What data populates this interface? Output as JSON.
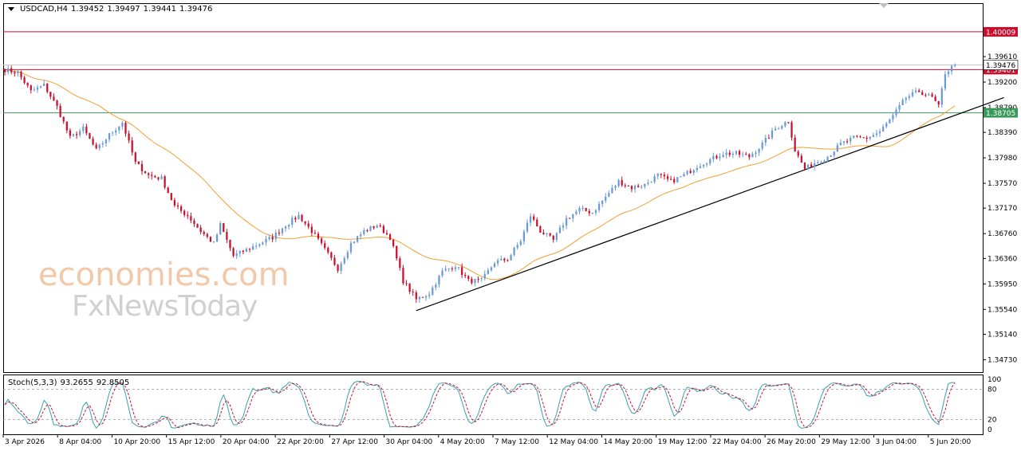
{
  "header": {
    "symbol": "USDCAD,H4",
    "open": "1.39452",
    "high": "1.39497",
    "low": "1.39441",
    "close": "1.39476"
  },
  "watermark": {
    "line1": "economies.com",
    "line2": "FxNewsToday"
  },
  "chart_data": [
    {
      "type": "candlestick",
      "title": "USDCAD,H4",
      "ylim": [
        1.3453,
        1.4047
      ],
      "y_ticks": [
        "1.34730",
        "1.35140",
        "1.35540",
        "1.35950",
        "1.36360",
        "1.36760",
        "1.37170",
        "1.37570",
        "1.37980",
        "1.38390",
        "1.38790",
        "1.39200",
        "1.39610"
      ],
      "x_ticks": [
        "3 Apr 2026",
        "8 Apr 04:00",
        "10 Apr 20:00",
        "15 Apr 12:00",
        "20 Apr 04:00",
        "22 Apr 20:00",
        "27 Apr 12:00",
        "30 Apr 04:00",
        "4 May 20:00",
        "7 May 12:00",
        "12 May 04:00",
        "14 May 20:00",
        "19 May 12:00",
        "22 May 04:00",
        "26 May 20:00",
        "29 May 12:00",
        "3 Jun 04:00",
        "5 Jun 20:00"
      ],
      "levels": [
        {
          "label": "1.40009",
          "value": 1.40009,
          "color": "#c8102e"
        },
        {
          "label": "1.39401",
          "value": 1.39401,
          "color": "#c8102e"
        },
        {
          "label": "1.38705",
          "value": 1.38705,
          "color": "#3a9a5c"
        },
        {
          "label": "1.39476",
          "value": 1.39476,
          "color": "#000000"
        }
      ],
      "trendline": {
        "start_value": 1.3552,
        "end_value": 1.3895,
        "color": "#000000"
      },
      "moving_average_color": "#f0a030",
      "bull_color": "#6a9ad8",
      "bear_color": "#c8102e",
      "anchors": [
        [
          0,
          1.394
        ],
        [
          4,
          1.3935
        ],
        [
          8,
          1.3905
        ],
        [
          12,
          1.3915
        ],
        [
          16,
          1.388
        ],
        [
          20,
          1.383
        ],
        [
          24,
          1.3845
        ],
        [
          28,
          1.381
        ],
        [
          32,
          1.3835
        ],
        [
          36,
          1.3855
        ],
        [
          40,
          1.379
        ],
        [
          44,
          1.377
        ],
        [
          48,
          1.3765
        ],
        [
          52,
          1.372
        ],
        [
          56,
          1.3705
        ],
        [
          60,
          1.368
        ],
        [
          64,
          1.366
        ],
        [
          66,
          1.369
        ],
        [
          70,
          1.364
        ],
        [
          74,
          1.365
        ],
        [
          78,
          1.366
        ],
        [
          82,
          1.367
        ],
        [
          86,
          1.369
        ],
        [
          90,
          1.3705
        ],
        [
          94,
          1.368
        ],
        [
          98,
          1.365
        ],
        [
          102,
          1.362
        ],
        [
          106,
          1.366
        ],
        [
          110,
          1.368
        ],
        [
          114,
          1.369
        ],
        [
          118,
          1.367
        ],
        [
          122,
          1.36
        ],
        [
          126,
          1.357
        ],
        [
          130,
          1.358
        ],
        [
          134,
          1.3615
        ],
        [
          138,
          1.3625
        ],
        [
          142,
          1.36
        ],
        [
          146,
          1.36
        ],
        [
          150,
          1.363
        ],
        [
          154,
          1.3635
        ],
        [
          158,
          1.3665
        ],
        [
          161,
          1.3705
        ],
        [
          164,
          1.368
        ],
        [
          168,
          1.3665
        ],
        [
          172,
          1.37
        ],
        [
          176,
          1.3715
        ],
        [
          180,
          1.371
        ],
        [
          184,
          1.3735
        ],
        [
          188,
          1.376
        ],
        [
          192,
          1.375
        ],
        [
          196,
          1.3755
        ],
        [
          200,
          1.377
        ],
        [
          204,
          1.376
        ],
        [
          208,
          1.377
        ],
        [
          212,
          1.3785
        ],
        [
          216,
          1.3795
        ],
        [
          220,
          1.3805
        ],
        [
          224,
          1.3805
        ],
        [
          228,
          1.38
        ],
        [
          232,
          1.382
        ],
        [
          236,
          1.3845
        ],
        [
          240,
          1.3858
        ],
        [
          242,
          1.381
        ],
        [
          245,
          1.378
        ],
        [
          248,
          1.379
        ],
        [
          252,
          1.38
        ],
        [
          256,
          1.382
        ],
        [
          260,
          1.383
        ],
        [
          264,
          1.383
        ],
        [
          268,
          1.384
        ],
        [
          272,
          1.3865
        ],
        [
          276,
          1.3895
        ],
        [
          280,
          1.3905
        ],
        [
          284,
          1.3895
        ],
        [
          286,
          1.388
        ],
        [
          288,
          1.3935
        ],
        [
          291,
          1.3948
        ]
      ]
    },
    {
      "type": "line",
      "title": "Stoch(5,3,3)",
      "values_label": [
        "93.2655",
        "92.8505"
      ],
      "ylim": [
        0,
        100
      ],
      "y_ticks": [
        "100",
        "80",
        "20",
        "0"
      ],
      "levels": [
        80,
        20
      ],
      "series": [
        {
          "name": "Stoch(5,3,3) main",
          "color": "#3aa0b0"
        },
        {
          "name": "Stoch(5,3,3) signal",
          "color": "#c8102e"
        }
      ],
      "last_values": [
        93.2655,
        92.8505
      ]
    }
  ]
}
